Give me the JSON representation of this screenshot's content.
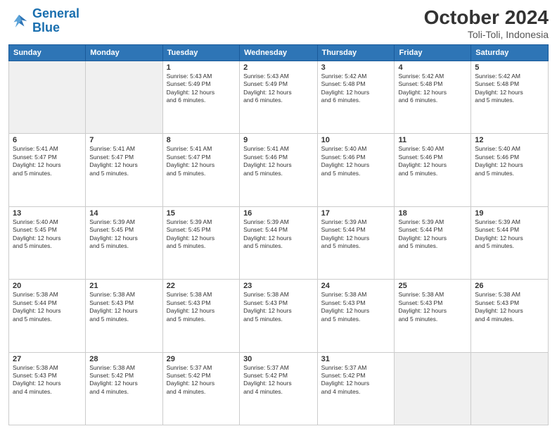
{
  "logo": {
    "line1": "General",
    "line2": "Blue"
  },
  "title": "October 2024",
  "location": "Toli-Toli, Indonesia",
  "headers": [
    "Sunday",
    "Monday",
    "Tuesday",
    "Wednesday",
    "Thursday",
    "Friday",
    "Saturday"
  ],
  "weeks": [
    [
      {
        "day": "",
        "sunrise": "",
        "sunset": "",
        "daylight": "",
        "empty": true
      },
      {
        "day": "",
        "sunrise": "",
        "sunset": "",
        "daylight": "",
        "empty": true
      },
      {
        "day": "1",
        "sunrise": "Sunrise: 5:43 AM",
        "sunset": "Sunset: 5:49 PM",
        "daylight": "Daylight: 12 hours and 6 minutes."
      },
      {
        "day": "2",
        "sunrise": "Sunrise: 5:43 AM",
        "sunset": "Sunset: 5:49 PM",
        "daylight": "Daylight: 12 hours and 6 minutes."
      },
      {
        "day": "3",
        "sunrise": "Sunrise: 5:42 AM",
        "sunset": "Sunset: 5:48 PM",
        "daylight": "Daylight: 12 hours and 6 minutes."
      },
      {
        "day": "4",
        "sunrise": "Sunrise: 5:42 AM",
        "sunset": "Sunset: 5:48 PM",
        "daylight": "Daylight: 12 hours and 6 minutes."
      },
      {
        "day": "5",
        "sunrise": "Sunrise: 5:42 AM",
        "sunset": "Sunset: 5:48 PM",
        "daylight": "Daylight: 12 hours and 5 minutes."
      }
    ],
    [
      {
        "day": "6",
        "sunrise": "Sunrise: 5:41 AM",
        "sunset": "Sunset: 5:47 PM",
        "daylight": "Daylight: 12 hours and 5 minutes."
      },
      {
        "day": "7",
        "sunrise": "Sunrise: 5:41 AM",
        "sunset": "Sunset: 5:47 PM",
        "daylight": "Daylight: 12 hours and 5 minutes."
      },
      {
        "day": "8",
        "sunrise": "Sunrise: 5:41 AM",
        "sunset": "Sunset: 5:47 PM",
        "daylight": "Daylight: 12 hours and 5 minutes."
      },
      {
        "day": "9",
        "sunrise": "Sunrise: 5:41 AM",
        "sunset": "Sunset: 5:46 PM",
        "daylight": "Daylight: 12 hours and 5 minutes."
      },
      {
        "day": "10",
        "sunrise": "Sunrise: 5:40 AM",
        "sunset": "Sunset: 5:46 PM",
        "daylight": "Daylight: 12 hours and 5 minutes."
      },
      {
        "day": "11",
        "sunrise": "Sunrise: 5:40 AM",
        "sunset": "Sunset: 5:46 PM",
        "daylight": "Daylight: 12 hours and 5 minutes."
      },
      {
        "day": "12",
        "sunrise": "Sunrise: 5:40 AM",
        "sunset": "Sunset: 5:46 PM",
        "daylight": "Daylight: 12 hours and 5 minutes."
      }
    ],
    [
      {
        "day": "13",
        "sunrise": "Sunrise: 5:40 AM",
        "sunset": "Sunset: 5:45 PM",
        "daylight": "Daylight: 12 hours and 5 minutes."
      },
      {
        "day": "14",
        "sunrise": "Sunrise: 5:39 AM",
        "sunset": "Sunset: 5:45 PM",
        "daylight": "Daylight: 12 hours and 5 minutes."
      },
      {
        "day": "15",
        "sunrise": "Sunrise: 5:39 AM",
        "sunset": "Sunset: 5:45 PM",
        "daylight": "Daylight: 12 hours and 5 minutes."
      },
      {
        "day": "16",
        "sunrise": "Sunrise: 5:39 AM",
        "sunset": "Sunset: 5:44 PM",
        "daylight": "Daylight: 12 hours and 5 minutes."
      },
      {
        "day": "17",
        "sunrise": "Sunrise: 5:39 AM",
        "sunset": "Sunset: 5:44 PM",
        "daylight": "Daylight: 12 hours and 5 minutes."
      },
      {
        "day": "18",
        "sunrise": "Sunrise: 5:39 AM",
        "sunset": "Sunset: 5:44 PM",
        "daylight": "Daylight: 12 hours and 5 minutes."
      },
      {
        "day": "19",
        "sunrise": "Sunrise: 5:39 AM",
        "sunset": "Sunset: 5:44 PM",
        "daylight": "Daylight: 12 hours and 5 minutes."
      }
    ],
    [
      {
        "day": "20",
        "sunrise": "Sunrise: 5:38 AM",
        "sunset": "Sunset: 5:44 PM",
        "daylight": "Daylight: 12 hours and 5 minutes."
      },
      {
        "day": "21",
        "sunrise": "Sunrise: 5:38 AM",
        "sunset": "Sunset: 5:43 PM",
        "daylight": "Daylight: 12 hours and 5 minutes."
      },
      {
        "day": "22",
        "sunrise": "Sunrise: 5:38 AM",
        "sunset": "Sunset: 5:43 PM",
        "daylight": "Daylight: 12 hours and 5 minutes."
      },
      {
        "day": "23",
        "sunrise": "Sunrise: 5:38 AM",
        "sunset": "Sunset: 5:43 PM",
        "daylight": "Daylight: 12 hours and 5 minutes."
      },
      {
        "day": "24",
        "sunrise": "Sunrise: 5:38 AM",
        "sunset": "Sunset: 5:43 PM",
        "daylight": "Daylight: 12 hours and 5 minutes."
      },
      {
        "day": "25",
        "sunrise": "Sunrise: 5:38 AM",
        "sunset": "Sunset: 5:43 PM",
        "daylight": "Daylight: 12 hours and 5 minutes."
      },
      {
        "day": "26",
        "sunrise": "Sunrise: 5:38 AM",
        "sunset": "Sunset: 5:43 PM",
        "daylight": "Daylight: 12 hours and 4 minutes."
      }
    ],
    [
      {
        "day": "27",
        "sunrise": "Sunrise: 5:38 AM",
        "sunset": "Sunset: 5:43 PM",
        "daylight": "Daylight: 12 hours and 4 minutes."
      },
      {
        "day": "28",
        "sunrise": "Sunrise: 5:38 AM",
        "sunset": "Sunset: 5:42 PM",
        "daylight": "Daylight: 12 hours and 4 minutes."
      },
      {
        "day": "29",
        "sunrise": "Sunrise: 5:37 AM",
        "sunset": "Sunset: 5:42 PM",
        "daylight": "Daylight: 12 hours and 4 minutes."
      },
      {
        "day": "30",
        "sunrise": "Sunrise: 5:37 AM",
        "sunset": "Sunset: 5:42 PM",
        "daylight": "Daylight: 12 hours and 4 minutes."
      },
      {
        "day": "31",
        "sunrise": "Sunrise: 5:37 AM",
        "sunset": "Sunset: 5:42 PM",
        "daylight": "Daylight: 12 hours and 4 minutes."
      },
      {
        "day": "",
        "sunrise": "",
        "sunset": "",
        "daylight": "",
        "empty": true
      },
      {
        "day": "",
        "sunrise": "",
        "sunset": "",
        "daylight": "",
        "empty": true
      }
    ]
  ]
}
